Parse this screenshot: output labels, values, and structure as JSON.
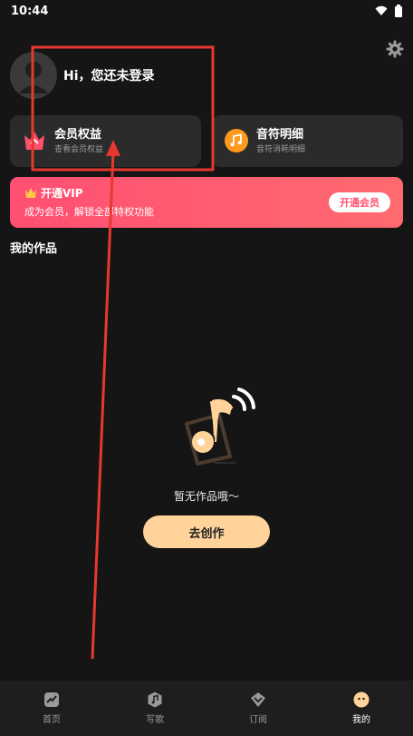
{
  "status_bar": {
    "time": "10:44"
  },
  "profile": {
    "greeting": "Hi，您还未登录"
  },
  "cards": [
    {
      "title": "会员权益",
      "subtitle": "查看会员权益",
      "icon": "crown-icon"
    },
    {
      "title": "音符明细",
      "subtitle": "音符消耗明细",
      "icon": "music-note-icon"
    }
  ],
  "vip": {
    "title": "开通VIP",
    "subtitle": "成为会员，解锁全部特权功能",
    "button": "开通会员"
  },
  "works": {
    "section_title": "我的作品",
    "empty_text": "暂无作品哦〜",
    "create_button": "去创作"
  },
  "bottom_nav": [
    {
      "label": "首页",
      "icon": "home-icon",
      "active": false
    },
    {
      "label": "写歌",
      "icon": "write-song-icon",
      "active": false
    },
    {
      "label": "订阅",
      "icon": "subscribe-icon",
      "active": false
    },
    {
      "label": "我的",
      "icon": "profile-face-icon",
      "active": true
    }
  ],
  "colors": {
    "background": "#151515",
    "card": "#2b2b2b",
    "accent_pink": "#ff4f72",
    "create_button": "#ffd39a",
    "annotation_red": "#e5392f"
  }
}
